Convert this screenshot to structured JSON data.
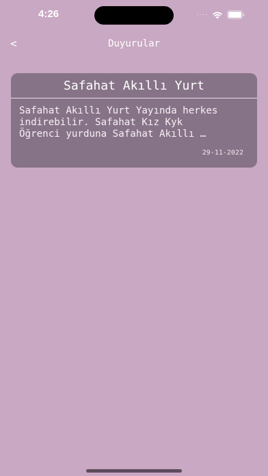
{
  "status_bar": {
    "time": "4:26",
    "signal_dots": "····"
  },
  "nav": {
    "back_label": "<",
    "title": "Duyurular"
  },
  "announcements": [
    {
      "title": "Safahat Akıllı Yurt",
      "body": "Safahat Akıllı Yurt Yayında herkes\nindirebilir. Safahat Kız Kyk\nÖğrenci yurduna Safahat Akıllı …",
      "date": "29-11-2022"
    }
  ],
  "colors": {
    "background": "#c8a8c2",
    "card": "#877387",
    "text": "#ffffff"
  },
  "icons": [
    "wifi-icon",
    "battery-icon",
    "signal-icon",
    "back-chevron-icon"
  ]
}
